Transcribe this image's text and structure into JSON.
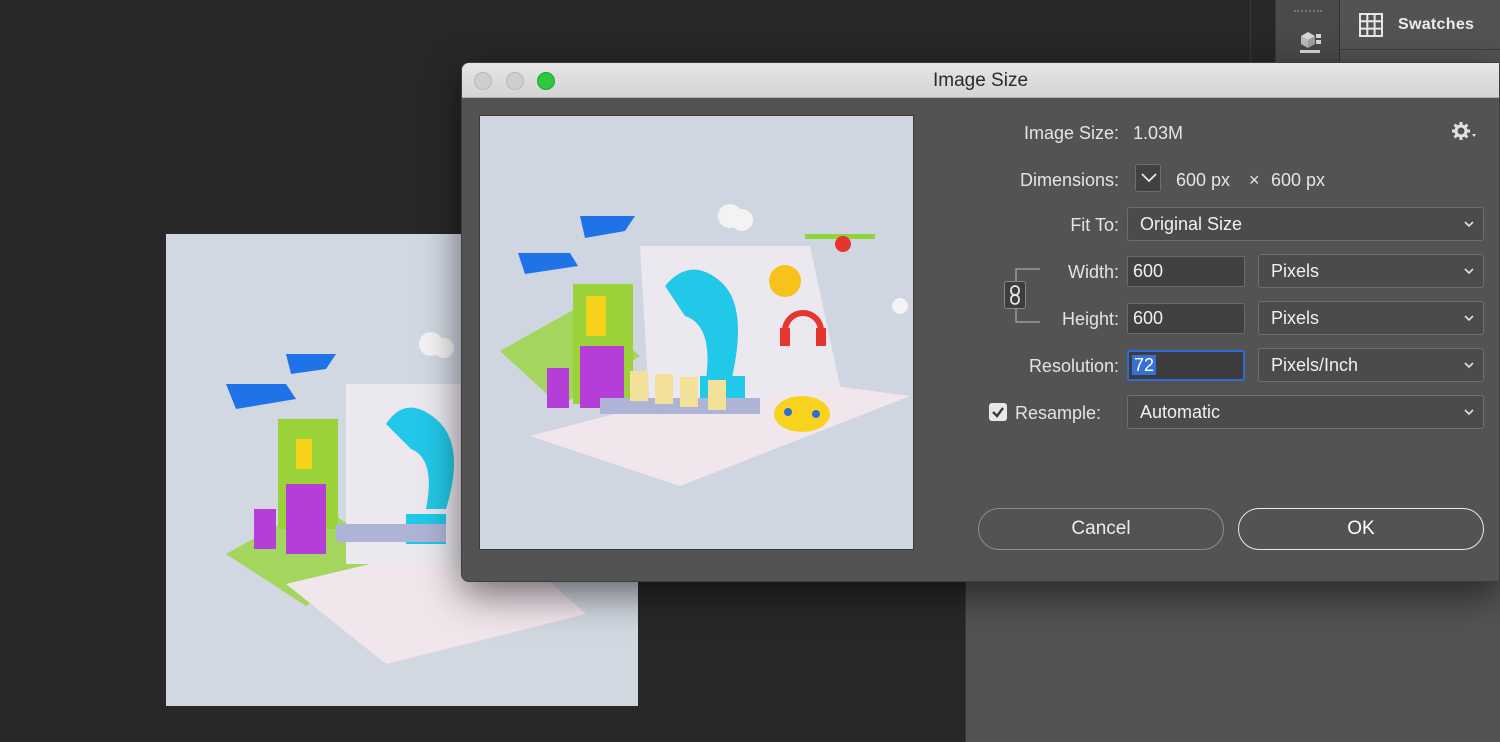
{
  "app": {
    "panel_tab": "Swatches"
  },
  "dialog": {
    "title": "Image Size",
    "image_size_label": "Image Size:",
    "image_size_value": "1.03M",
    "dimensions_label": "Dimensions:",
    "dim_width": "600 px",
    "dim_times": "×",
    "dim_height": "600 px",
    "fit_to_label": "Fit To:",
    "fit_to_value": "Original Size",
    "width_label": "Width:",
    "width_value": "600",
    "width_unit": "Pixels",
    "height_label": "Height:",
    "height_value": "600",
    "height_unit": "Pixels",
    "resolution_label": "Resolution:",
    "resolution_value": "72",
    "resolution_unit": "Pixels/Inch",
    "resample_label": "Resample:",
    "resample_checked": true,
    "resample_value": "Automatic",
    "cancel_label": "Cancel",
    "ok_label": "OK"
  },
  "icons": {
    "settings": "gear-icon",
    "link": "chain-link-icon",
    "swatches": "grid-icon",
    "panel": "cube-icon"
  },
  "colors": {
    "app_bg": "#282828",
    "panel_bg": "#535353",
    "focus_accent": "#2d6bd5",
    "maximize_green": "#2bc840"
  }
}
